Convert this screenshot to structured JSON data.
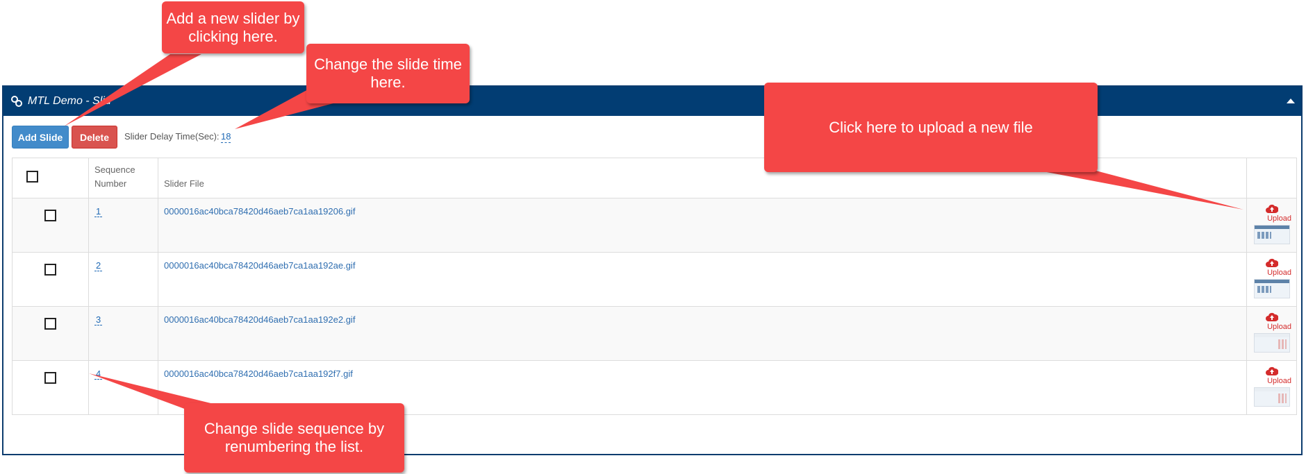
{
  "panel": {
    "title": "MTL Demo - Slid"
  },
  "toolbar": {
    "add_label": "Add Slide",
    "delete_label": "Delete",
    "delay_label": "Slider Delay Time(Sec):",
    "delay_value": "18"
  },
  "table": {
    "headers": {
      "sequence": "Sequence Number",
      "file": "Slider File"
    },
    "upload_label": "Upload",
    "rows": [
      {
        "seq": "1",
        "file": "0000016ac40bca78420d46aeb7ca1aa19206.gif"
      },
      {
        "seq": "2",
        "file": "0000016ac40bca78420d46aeb7ca1aa192ae.gif"
      },
      {
        "seq": "3",
        "file": "0000016ac40bca78420d46aeb7ca1aa192e2.gif"
      },
      {
        "seq": "4",
        "file": "0000016ac40bca78420d46aeb7ca1aa192f7.gif"
      }
    ]
  },
  "callouts": {
    "add_slider": "Add a new slider by clicking here.",
    "slide_time": "Change the slide time here.",
    "upload": "Click here to upload a new file",
    "sequence": "Change slide sequence by renumbering the list."
  },
  "colors": {
    "header": "#023d73",
    "callout": "#f44646",
    "add_button": "#428bca",
    "delete_button": "#d9534f",
    "highlight": "#fbfb2e"
  }
}
